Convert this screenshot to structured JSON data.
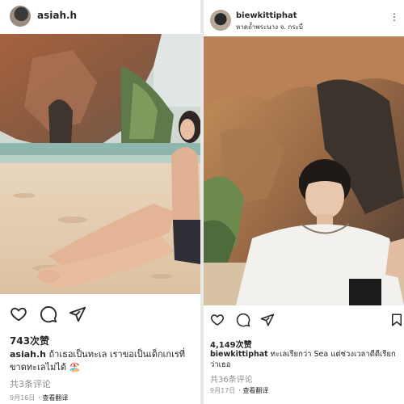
{
  "posts": [
    {
      "username": "asiah.h",
      "likes": "743次赞",
      "caption_user": "asiah.h",
      "caption_text": " ถ้าเธอเป็นทะเล เราขอเป็นเด็กเกเรที่ขาดทะเลไม่ได้ 🏖️",
      "comments": "共3条评论",
      "date": "9月16日",
      "translate": "· 查看翻译"
    },
    {
      "username": "biewkittiphat",
      "location": "หาดถ้ำพระนาง จ. กระบี่",
      "likes": "4,149次赞",
      "caption_user": "biewkittiphat",
      "caption_text": " ทะเลเรียกว่า Sea แต่ช่วงเวลาดีดีเรียกว่าเธอ",
      "comments": "共36条评论",
      "date": "9月17日",
      "translate": "· 查看翻译"
    }
  ],
  "icons": [
    "heart-icon",
    "comment-icon",
    "share-icon",
    "bookmark-icon",
    "more-icon"
  ]
}
